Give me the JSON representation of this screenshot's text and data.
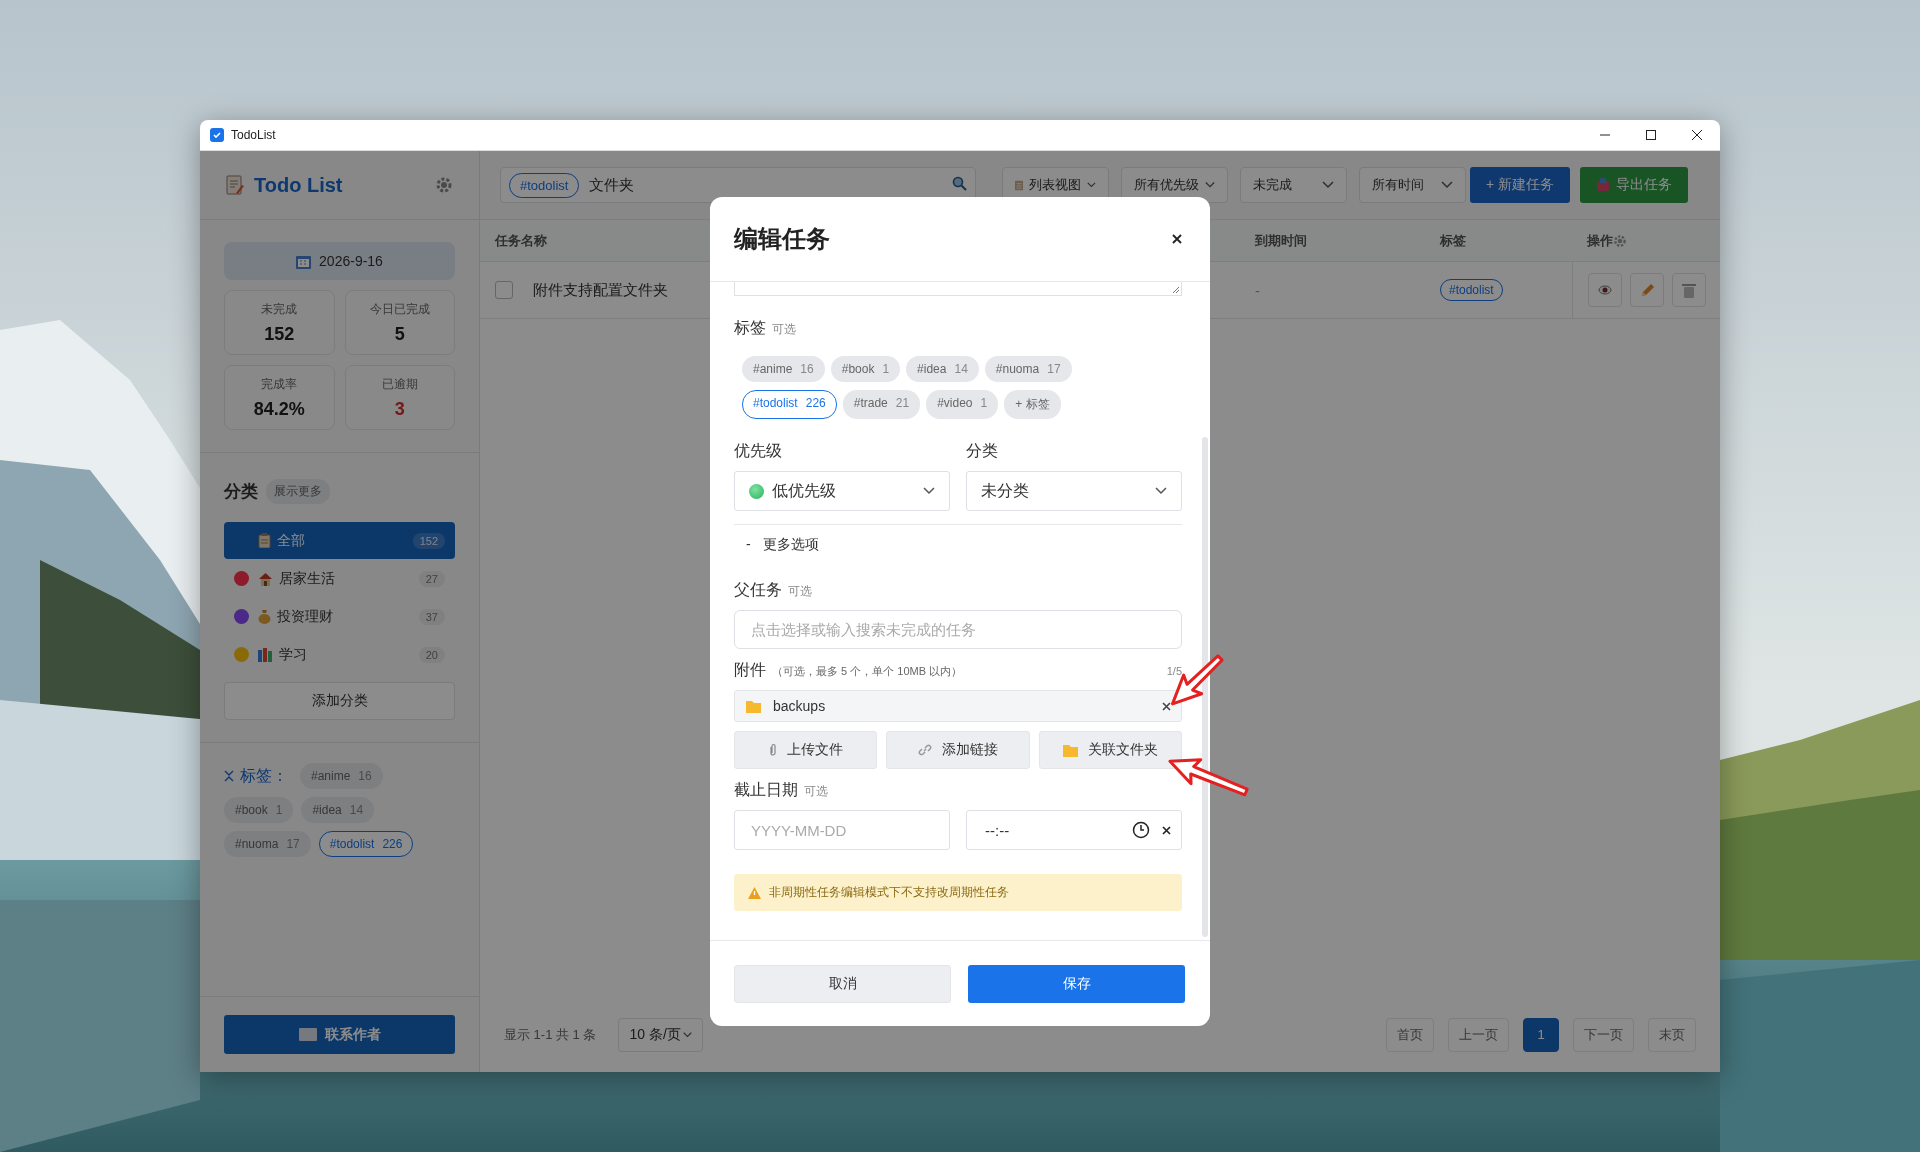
{
  "window": {
    "title": "TodoList"
  },
  "sidebar": {
    "app_title": "Todo List",
    "date": "2026-9-16",
    "stats": [
      {
        "label": "未完成",
        "value": "152",
        "kind": "normal"
      },
      {
        "label": "今日已完成",
        "value": "5",
        "kind": "normal"
      },
      {
        "label": "完成率",
        "value": "84.2%",
        "kind": "normal"
      },
      {
        "label": "已逾期",
        "value": "3",
        "kind": "alert"
      }
    ],
    "categories_title": "分类",
    "show_more": "展示更多",
    "categories": [
      {
        "label": "全部",
        "count": "152",
        "selected": true
      },
      {
        "label": "居家生活",
        "count": "27",
        "selected": false,
        "color": "#8c1c2c"
      },
      {
        "label": "投资理财",
        "count": "37",
        "selected": false,
        "color": "#4a2a88"
      },
      {
        "label": "学习",
        "count": "20",
        "selected": false,
        "color": "#8a6a08"
      }
    ],
    "add_category": "添加分类",
    "tags_title": "标签：",
    "tags": [
      {
        "label": "#anime",
        "count": "16",
        "selected": false
      },
      {
        "label": "#book",
        "count": "1",
        "selected": false
      },
      {
        "label": "#idea",
        "count": "14",
        "selected": false
      },
      {
        "label": "#nuoma",
        "count": "17",
        "selected": false
      },
      {
        "label": "#todolist",
        "count": "226",
        "selected": true
      }
    ],
    "contact": "联系作者"
  },
  "toolbar": {
    "search_tag": "#todolist",
    "search_value": "文件夹",
    "filters": [
      "列表视图",
      "所有优先级",
      "未完成",
      "所有时间"
    ],
    "new_task": "+ 新建任务",
    "export": "导出任务"
  },
  "table": {
    "columns": [
      "任务名称",
      "到期时间",
      "标签",
      "操作"
    ],
    "rows": [
      {
        "checked": false,
        "name": "附件支持配置文件夹",
        "due": "-",
        "tag": "#todolist"
      }
    ]
  },
  "pagination": {
    "summary": "显示 1-1 共 1 条",
    "page_size": "10 条/页",
    "first": "首页",
    "prev": "上一页",
    "pages": [
      {
        "label": "1",
        "selected": true
      }
    ],
    "next": "下一页",
    "last": "末页"
  },
  "dialog": {
    "title": "编辑任务",
    "tags_label": "标签",
    "tags_optional": "可选",
    "tags": [
      {
        "label": "#anime",
        "count": "16",
        "selected": false
      },
      {
        "label": "#book",
        "count": "1",
        "selected": false
      },
      {
        "label": "#idea",
        "count": "14",
        "selected": false
      },
      {
        "label": "#nuoma",
        "count": "17",
        "selected": false
      },
      {
        "label": "#todolist",
        "count": "226",
        "selected": true
      },
      {
        "label": "#trade",
        "count": "21",
        "selected": false
      },
      {
        "label": "#video",
        "count": "1",
        "selected": false
      }
    ],
    "add_tag": "+ 标签",
    "priority_label": "优先级",
    "priority_value": "低优先级",
    "category_label": "分类",
    "category_value": "未分类",
    "more_options": {
      "marker": "-",
      "label": "更多选项"
    },
    "parent_label": "父任务",
    "parent_optional": "可选",
    "parent_placeholder": "点击选择或输入搜索未完成的任务",
    "attachments_label": "附件",
    "attachments_hint": "（可选，最多 5 个，单个 10MB 以内）",
    "attachments_count": "1/5",
    "attachments": [
      {
        "name": "backups"
      }
    ],
    "attach_buttons": [
      "上传文件",
      "添加链接",
      "关联文件夹"
    ],
    "due_label": "截止日期",
    "due_optional": "可选",
    "date_placeholder": "YYYY-MM-DD",
    "time_placeholder": "--:--",
    "warning": "非周期性任务编辑模式下不支持改周期性任务",
    "cancel": "取消",
    "save": "保存"
  }
}
